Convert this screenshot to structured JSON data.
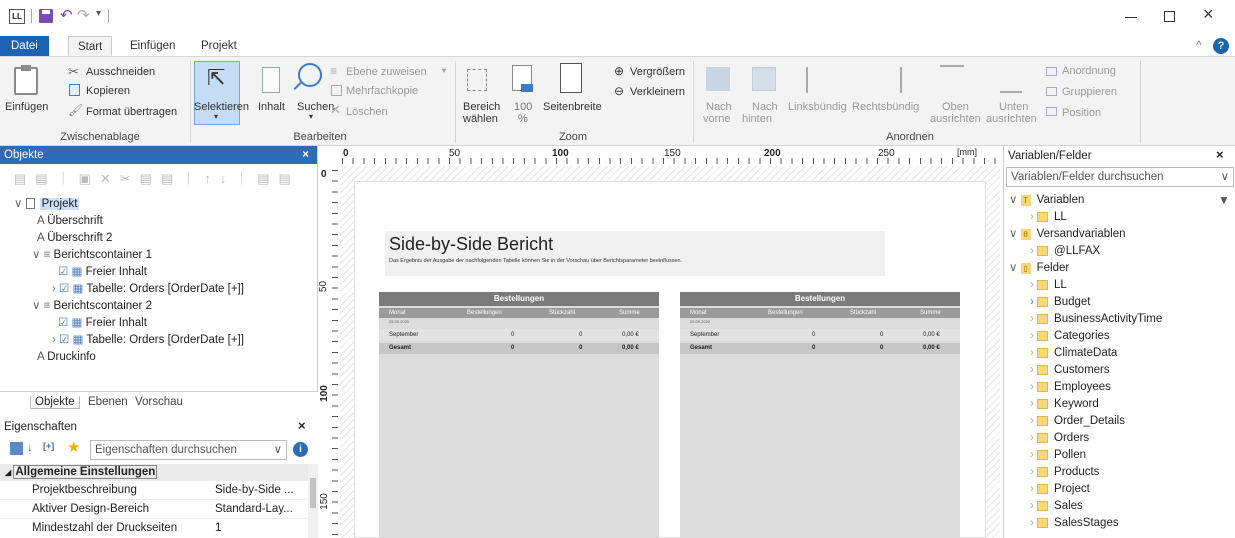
{
  "title_bar": {
    "app_icon": "LL"
  },
  "tabs": [
    "Datei",
    "Start",
    "Einfügen",
    "Projekt"
  ],
  "ribbon": {
    "groups": {
      "clipboard": {
        "label": "Zwischenablage",
        "paste": "Einfügen",
        "cut": "Ausschneiden",
        "copy": "Kopieren",
        "format": "Format übertragen"
      },
      "edit": {
        "label": "Bearbeiten",
        "select": "Selektieren",
        "content": "Inhalt",
        "search": "Suchen",
        "assign_layer": "Ebene zuweisen",
        "multi_copy": "Mehrfachkopie",
        "delete": "Löschen"
      },
      "zoom": {
        "label": "Zoom",
        "area": "Bereich",
        "area2": "wählen",
        "pct": "100",
        "pct2": "%",
        "page_width": "Seitenbreite",
        "zoom_in": "Vergrößern",
        "zoom_out": "Verkleinern"
      },
      "arrange": {
        "label": "Anordnen",
        "to_front": "Nach",
        "to_front2": "vorne",
        "to_back": "Nach",
        "to_back2": "hinten",
        "left": "Linksbündig",
        "right": "Rechtsbündig",
        "top": "Oben",
        "top2": "ausrichten",
        "bottom": "Unten",
        "bottom2": "ausrichten",
        "order": "Anordnung",
        "group": "Gruppieren",
        "position": "Position"
      }
    }
  },
  "objects_panel": {
    "title": "Objekte",
    "tree": [
      {
        "label": "Projekt"
      },
      {
        "label": "Überschrift"
      },
      {
        "label": "Überschrift 2"
      },
      {
        "label": "Berichtscontainer 1"
      },
      {
        "label": "Freier Inhalt"
      },
      {
        "label": "Tabelle: Orders [OrderDate [+]]"
      },
      {
        "label": "Berichtscontainer 2"
      },
      {
        "label": "Freier Inhalt"
      },
      {
        "label": "Tabelle: Orders [OrderDate [+]]"
      },
      {
        "label": "Druckinfo"
      }
    ],
    "bottom_tabs": [
      "Objekte",
      "Ebenen",
      "Vorschau"
    ]
  },
  "properties_panel": {
    "title": "Eigenschaften",
    "search_placeholder": "Eigenschaften durchsuchen",
    "section": "Allgemeine Einstellungen",
    "rows": [
      {
        "name": "Projektbeschreibung",
        "value": "Side-by-Side ..."
      },
      {
        "name": "Aktiver Design-Bereich",
        "value": "Standard-Lay..."
      },
      {
        "name": "Mindestzahl der Druckseiten",
        "value": "1"
      }
    ]
  },
  "ruler": {
    "top_labels": [
      "0",
      "50",
      "100",
      "150",
      "200",
      "250"
    ],
    "unit": "[mm]",
    "left_labels": [
      "0",
      "50",
      "100",
      "150"
    ]
  },
  "report": {
    "title": "Side-by-Side Bericht",
    "subtitle": "Das Ergebnis der Ausgabe der nachfolgenden Tabelle können Sie in der Vorschau über Berichtsparameter beeinflussen.",
    "tables": [
      {
        "header": "Bestellungen",
        "cols": [
          "Monat",
          "Bestellungen",
          "Stückzahl",
          "Summe"
        ],
        "date": "25.09.2020",
        "row": [
          "September",
          "0",
          "0",
          "0,00 €"
        ],
        "total": [
          "Gesamt",
          "0",
          "0",
          "0,00 €"
        ]
      },
      {
        "header": "Bestellungen",
        "cols": [
          "Monat",
          "Bestellungen",
          "Stückzahl",
          "Summe"
        ],
        "date": "25.09.2020",
        "row": [
          "September",
          "0",
          "0",
          "0,00 €"
        ],
        "total": [
          "Gesamt",
          "0",
          "0",
          "0,00 €"
        ]
      }
    ]
  },
  "variables_panel": {
    "title": "Variablen/Felder",
    "search_placeholder": "Variablen/Felder durchsuchen",
    "tree": [
      {
        "label": "Variablen"
      },
      {
        "label": "LL"
      },
      {
        "label": "Versandvariablen"
      },
      {
        "label": "@LLFAX"
      },
      {
        "label": "Felder"
      },
      {
        "label": "LL"
      },
      {
        "label": "Budget"
      },
      {
        "label": "BusinessActivityTime"
      },
      {
        "label": "Categories"
      },
      {
        "label": "ClimateData"
      },
      {
        "label": "Customers"
      },
      {
        "label": "Employees"
      },
      {
        "label": "Keyword"
      },
      {
        "label": "Order_Details"
      },
      {
        "label": "Orders"
      },
      {
        "label": "Pollen"
      },
      {
        "label": "Products"
      },
      {
        "label": "Project"
      },
      {
        "label": "Sales"
      },
      {
        "label": "SalesStages"
      }
    ]
  },
  "colors": {
    "accent": "#1a63b5",
    "panel_header": "#2d6cb5",
    "table_header": "#7a7a7a"
  }
}
